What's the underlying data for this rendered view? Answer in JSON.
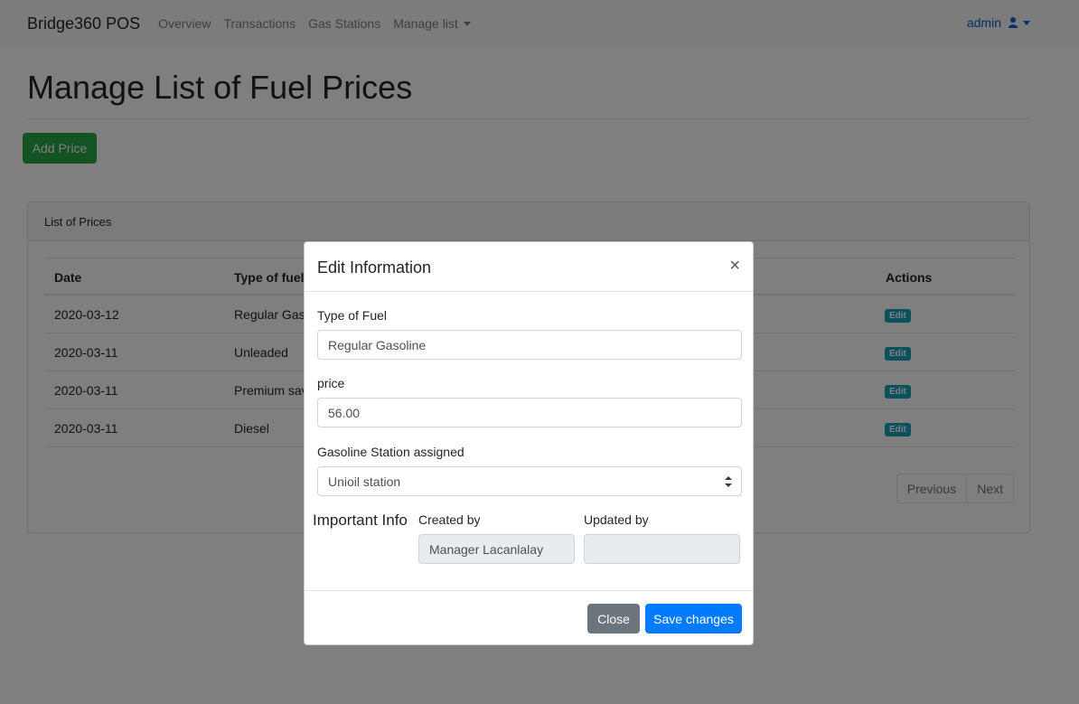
{
  "navbar": {
    "brand": "Bridge360 POS",
    "links": [
      "Overview",
      "Transactions",
      "Gas Stations",
      "Manage list"
    ],
    "user": "admin"
  },
  "page": {
    "title": "Manage List of Fuel Prices",
    "add_button": "Add Price"
  },
  "card": {
    "header": "List of Prices",
    "columns": [
      "Date",
      "Type of fuel",
      "Actions"
    ],
    "rows": [
      {
        "date": "2020-03-12",
        "fuel": "Regular Gaso",
        "action": "Edit"
      },
      {
        "date": "2020-03-11",
        "fuel": "Unleaded",
        "action": "Edit"
      },
      {
        "date": "2020-03-11",
        "fuel": "Premium sav",
        "action": "Edit"
      },
      {
        "date": "2020-03-11",
        "fuel": "Diesel",
        "action": "Edit"
      }
    ],
    "pagination": {
      "previous": "Previous",
      "next": "Next"
    }
  },
  "modal": {
    "title": "Edit Information",
    "close_symbol": "×",
    "fuel_type_label": "Type of Fuel",
    "fuel_type_value": "Regular Gasoline",
    "price_label": "price",
    "price_value": "56.00",
    "station_label": "Gasoline Station assigned",
    "station_value": "Unioil station",
    "important_label": "Important Info",
    "created_by_label": "Created by",
    "created_by_value": "Manager Lacanlalay",
    "updated_by_label": "Updated by",
    "updated_by_value": "",
    "close_button": "Close",
    "save_button": "Save changes"
  }
}
